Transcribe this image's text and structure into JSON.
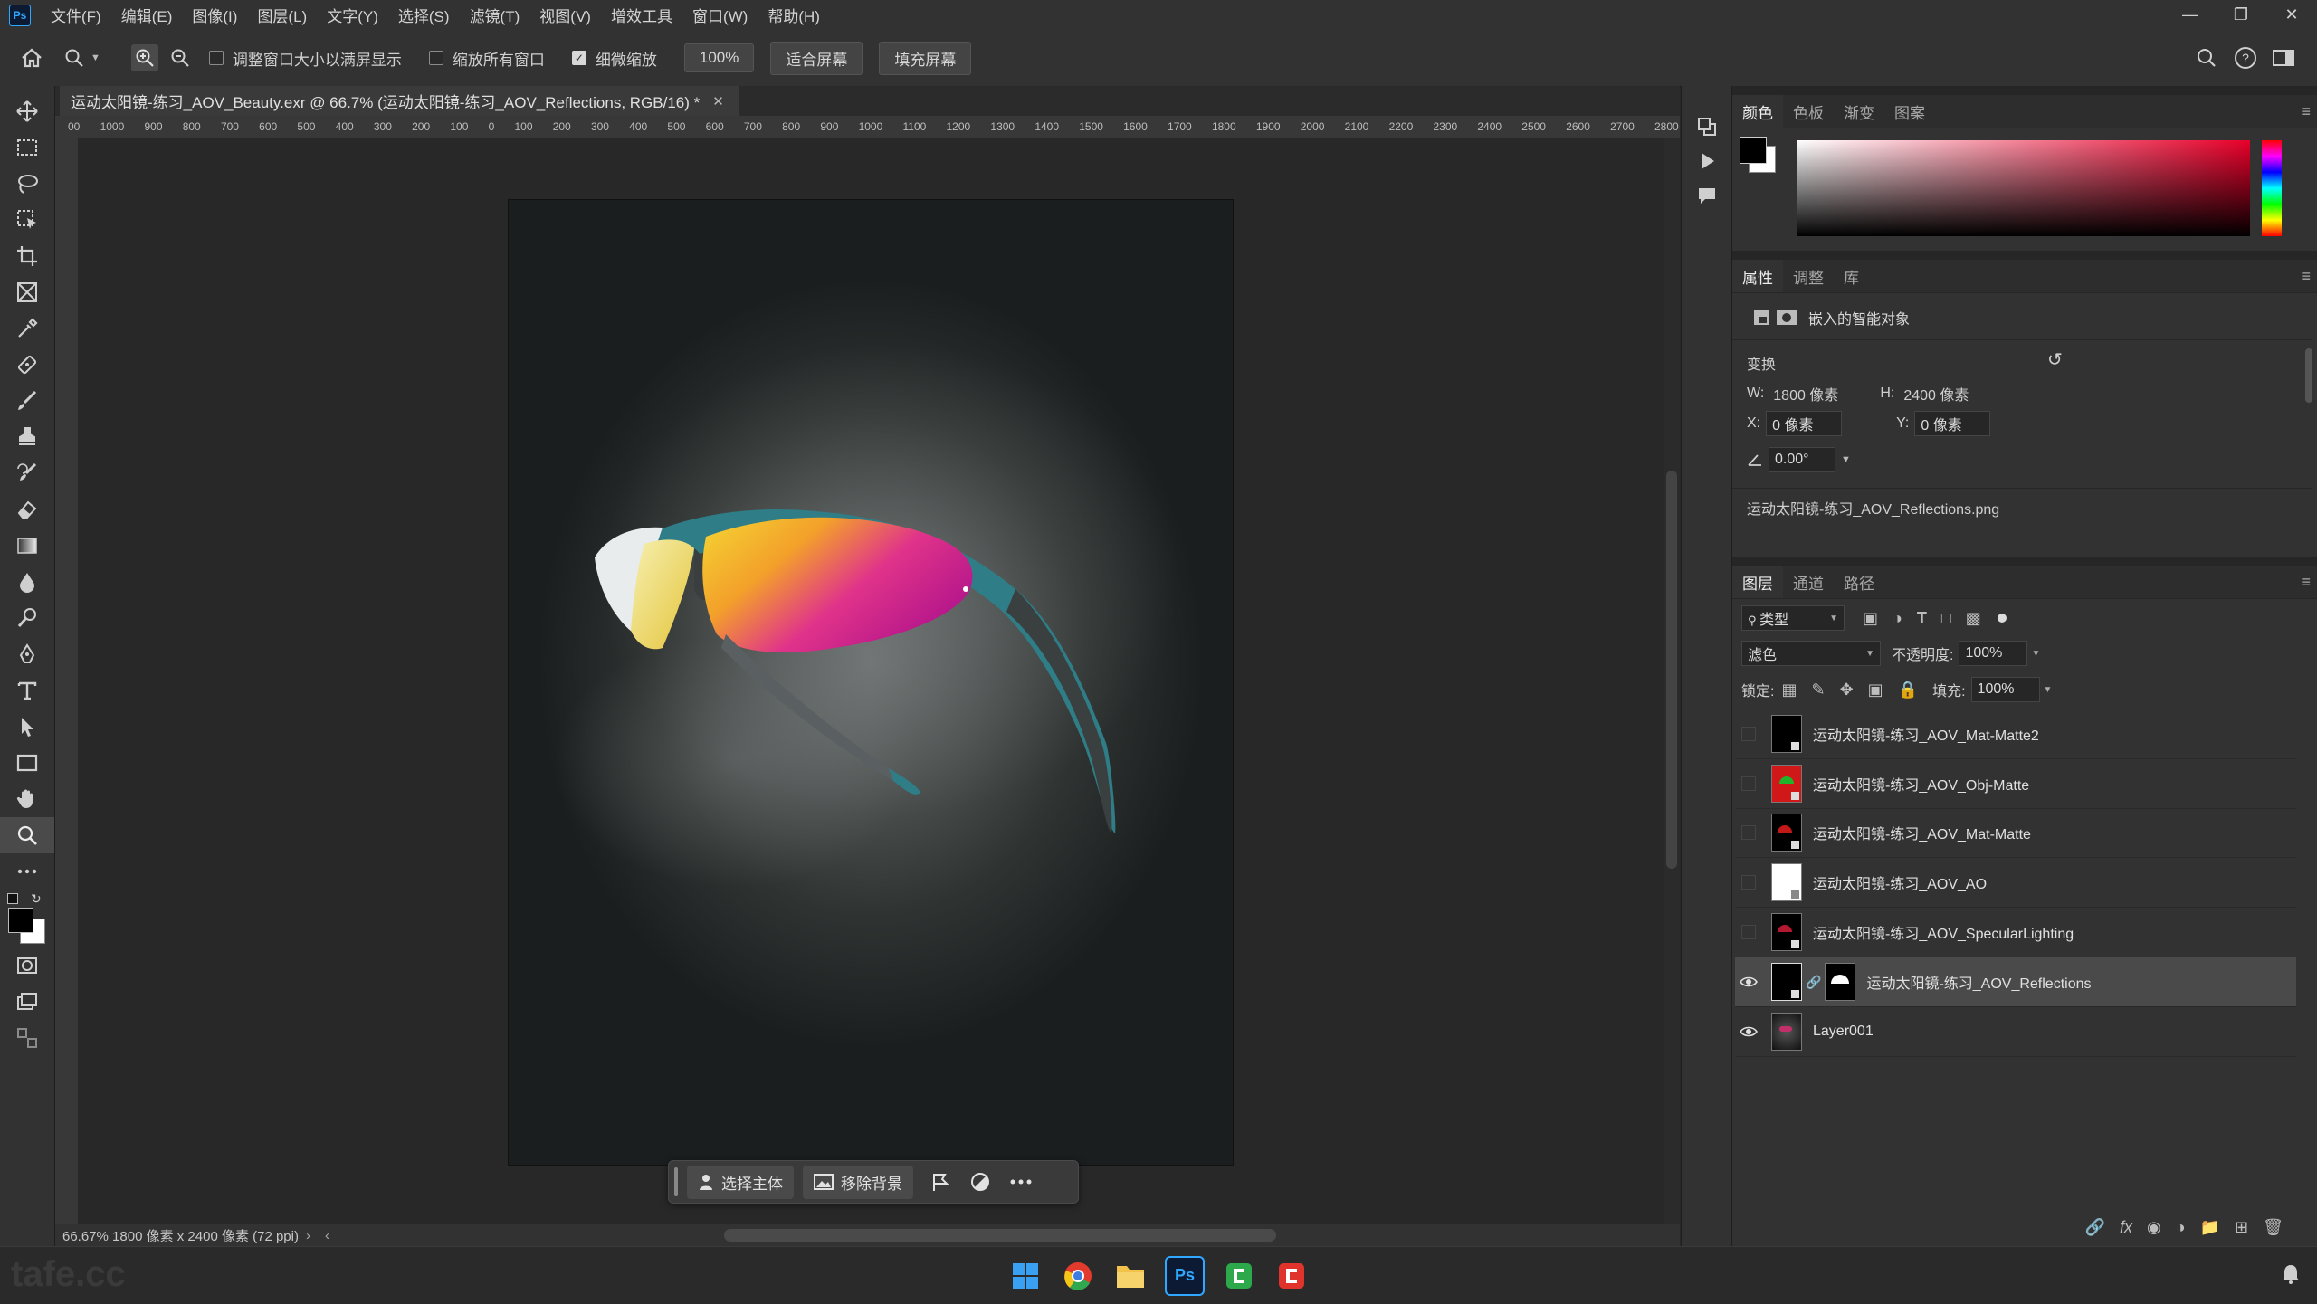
{
  "menubar": {
    "items": [
      "文件(F)",
      "编辑(E)",
      "图像(I)",
      "图层(L)",
      "文字(Y)",
      "选择(S)",
      "滤镜(T)",
      "视图(V)",
      "增效工具",
      "窗口(W)",
      "帮助(H)"
    ],
    "window_controls": [
      "minimize",
      "restore",
      "close"
    ]
  },
  "options": {
    "fit_window_label": "调整窗口大小以满屏显示",
    "zoom_all_label": "缩放所有窗口",
    "scrubby_zoom_label": "细微缩放",
    "zoom_value": "100%",
    "fit_screen_label": "适合屏幕",
    "fill_screen_label": "填充屏幕"
  },
  "document": {
    "tab_title": "运动太阳镜-练习_AOV_Beauty.exr @ 66.7% (运动太阳镜-练习_AOV_Reflections, RGB/16) *",
    "ruler_ticks": [
      "00",
      "1000",
      "900",
      "800",
      "700",
      "600",
      "500",
      "400",
      "300",
      "200",
      "100",
      "0",
      "100",
      "200",
      "300",
      "400",
      "500",
      "600",
      "700",
      "800",
      "900",
      "1000",
      "1100",
      "1200",
      "1300",
      "1400",
      "1500",
      "1600",
      "1700",
      "1800",
      "1900",
      "2000",
      "2100",
      "2200",
      "2300",
      "2400",
      "2500",
      "2600",
      "2700",
      "2800"
    ],
    "status": "66.67%   1800 像素 x 2400 像素 (72 ppi)"
  },
  "context_bar": {
    "select_subject": "选择主体",
    "remove_bg": "移除背景"
  },
  "color_panel": {
    "tabs": [
      "颜色",
      "色板",
      "渐变",
      "图案"
    ]
  },
  "properties": {
    "tabs": [
      "属性",
      "调整",
      "库"
    ],
    "object_type": "嵌入的智能对象",
    "transform_label": "变换",
    "w_label": "W:",
    "w_value": "1800 像素",
    "h_label": "H:",
    "h_value": "2400 像素",
    "x_label": "X:",
    "x_value": "0 像素",
    "y_label": "Y:",
    "y_value": "0 像素",
    "angle_value": "0.00°",
    "linked_file": "运动太阳镜-练习_AOV_Reflections.png"
  },
  "layers_panel": {
    "tabs": [
      "图层",
      "通道",
      "路径"
    ],
    "filter_kind": "类型",
    "blend_mode": "滤色",
    "opacity_label": "不透明度:",
    "opacity_value": "100%",
    "lock_label": "锁定:",
    "fill_label": "填充:",
    "fill_value": "100%",
    "layers": [
      {
        "name": "运动太阳镜-练习_AOV_Mat-Matte2",
        "visible": false
      },
      {
        "name": "运动太阳镜-练习_AOV_Obj-Matte",
        "visible": false
      },
      {
        "name": "运动太阳镜-练习_AOV_Mat-Matte",
        "visible": false
      },
      {
        "name": "运动太阳镜-练习_AOV_AO",
        "visible": false
      },
      {
        "name": "运动太阳镜-练习_AOV_SpecularLighting",
        "visible": false
      },
      {
        "name": "运动太阳镜-练习_AOV_Reflections",
        "visible": true,
        "selected": true
      },
      {
        "name": "Layer001",
        "visible": true
      }
    ]
  },
  "taskbar": {
    "apps": [
      "windows-start",
      "chrome",
      "file-explorer",
      "photoshop",
      "camtasia",
      "camtasia-recorder"
    ],
    "ps_label": "Ps"
  },
  "watermark": "tafe.cc",
  "colors": {
    "accent": "#31a8ff",
    "panel_bg": "#323232",
    "app_bg": "#282828",
    "lens_yellow": "#f2c52a",
    "lens_magenta": "#d81a8c",
    "frame_teal": "#2f7d86"
  }
}
